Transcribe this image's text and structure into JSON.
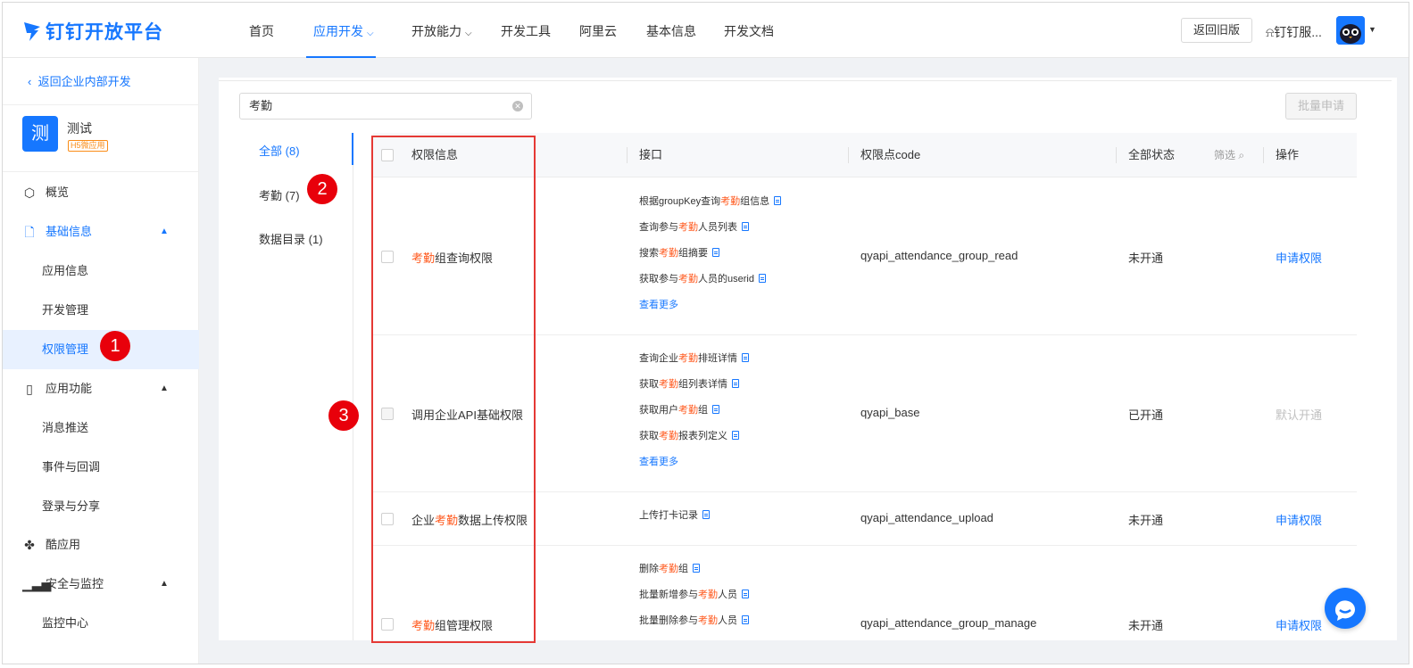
{
  "topnav": {
    "logo_text": "钉钉开放平台",
    "items": [
      {
        "label": "首页"
      },
      {
        "label": "应用开发",
        "active": true
      },
      {
        "label": "开放能力"
      },
      {
        "label": "开发工具"
      },
      {
        "label": "阿里云"
      },
      {
        "label": "基本信息"
      },
      {
        "label": "开发文档"
      }
    ],
    "old_version_button": "返回旧版",
    "user_name": "钉钉服..."
  },
  "sidebar": {
    "back_link": "返回企业内部开发",
    "app": {
      "icon_char": "测",
      "name": "测试",
      "tag": "H5微应用"
    },
    "menu": [
      {
        "label": "概览",
        "icon": "cube-icon"
      },
      {
        "label": "基础信息",
        "icon": "document-icon",
        "expanded": true
      },
      {
        "label": "应用信息"
      },
      {
        "label": "开发管理"
      },
      {
        "label": "权限管理",
        "selected": true
      },
      {
        "label": "应用功能",
        "icon": "phone-icon",
        "expanded": true
      },
      {
        "label": "消息推送"
      },
      {
        "label": "事件与回调"
      },
      {
        "label": "登录与分享"
      },
      {
        "label": "酷应用",
        "icon": "cool-app-icon"
      },
      {
        "label": "安全与监控",
        "icon": "chart-icon",
        "expanded": true
      },
      {
        "label": "监控中心"
      }
    ]
  },
  "search": {
    "value": "考勤"
  },
  "batch_button": "批量申请",
  "categories": [
    {
      "label": "全部",
      "count": "(8)",
      "active": true
    },
    {
      "label": "考勤",
      "count": "(7)"
    },
    {
      "label": "数据目录",
      "count": "(1)"
    }
  ],
  "table": {
    "headers": {
      "perm_info": "权限信息",
      "api": "接口",
      "code": "权限点code",
      "status": "全部状态",
      "filter": "筛选",
      "action": "操作"
    },
    "rows": [
      {
        "name_pre": "",
        "name_hl": "考勤",
        "name_post": "组查询权限",
        "apis": [
          {
            "pre": "根据groupKey查询",
            "hl": "考勤",
            "post": "组信息"
          },
          {
            "pre": "查询参与",
            "hl": "考勤",
            "post": "人员列表"
          },
          {
            "pre": "搜索",
            "hl": "考勤",
            "post": "组摘要"
          },
          {
            "pre": "获取参与",
            "hl": "考勤",
            "post": "人员的userid"
          }
        ],
        "more": "查看更多",
        "code": "qyapi_attendance_group_read",
        "status": "未开通",
        "action": "申请权限"
      },
      {
        "name_pre": "调用企业API基础权限",
        "name_hl": "",
        "name_post": "",
        "apis": [
          {
            "pre": "查询企业",
            "hl": "考勤",
            "post": "排班详情"
          },
          {
            "pre": "获取",
            "hl": "考勤",
            "post": "组列表详情"
          },
          {
            "pre": "获取用户",
            "hl": "考勤",
            "post": "组"
          },
          {
            "pre": "获取",
            "hl": "考勤",
            "post": "报表列定义"
          }
        ],
        "more": "查看更多",
        "code": "qyapi_base",
        "status": "已开通",
        "action": "默认开通"
      },
      {
        "name_pre": "企业",
        "name_hl": "考勤",
        "name_post": "数据上传权限",
        "apis": [
          {
            "pre": "上传打卡记录",
            "hl": "",
            "post": ""
          }
        ],
        "code": "qyapi_attendance_upload",
        "status": "未开通",
        "action": "申请权限"
      },
      {
        "name_pre": "",
        "name_hl": "考勤",
        "name_post": "组管理权限",
        "apis": [
          {
            "pre": "删除",
            "hl": "考勤",
            "post": "组"
          },
          {
            "pre": "批量新增参与",
            "hl": "考勤",
            "post": "人员"
          },
          {
            "pre": "批量删除参与",
            "hl": "考勤",
            "post": "人员"
          }
        ],
        "code": "qyapi_attendance_group_manage",
        "status": "未开通",
        "action": "申请权限"
      }
    ]
  },
  "annotations": {
    "badge1": "1",
    "badge2": "2",
    "badge3": "3"
  },
  "colors": {
    "accent": "#1677ff",
    "highlight": "#ff5a1f",
    "annotation_red": "#e53935"
  }
}
